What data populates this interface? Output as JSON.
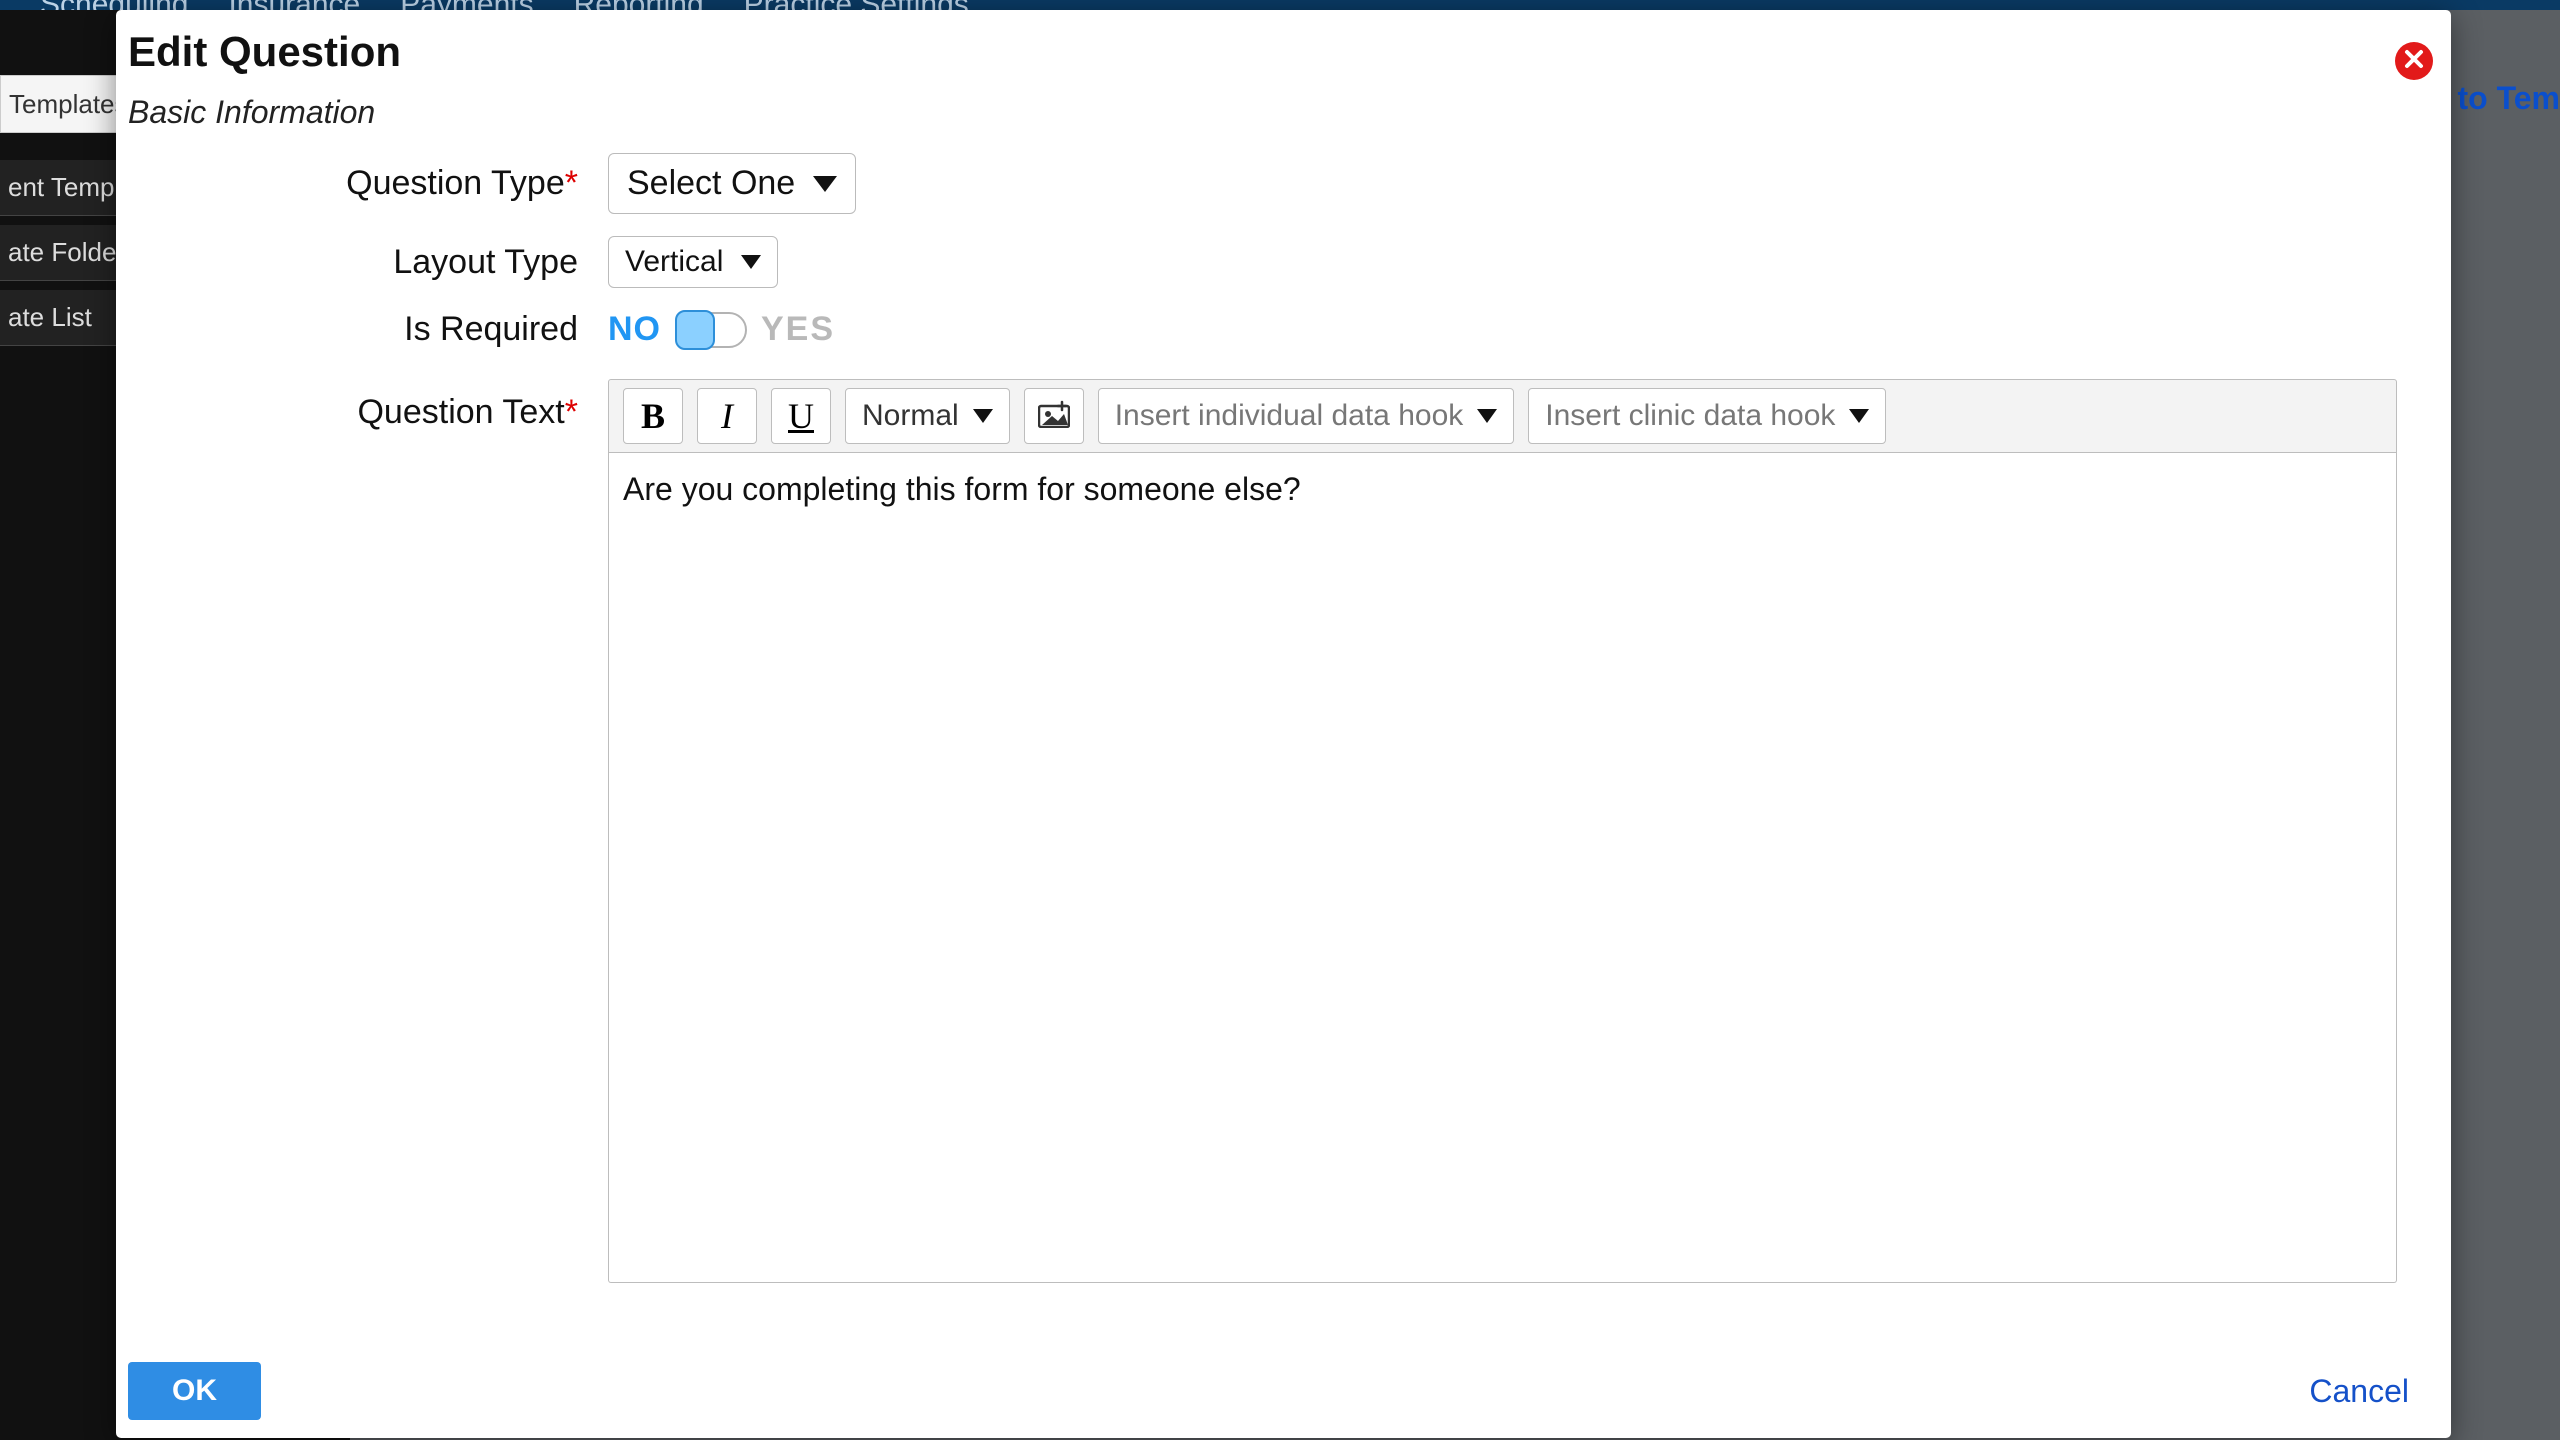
{
  "background": {
    "nav": [
      "Scheduling",
      "Insurance",
      "Payments",
      "Reporting",
      "Practice Settings"
    ],
    "tab": "Templates",
    "side_items": [
      "ent Temp",
      "ate Folde",
      "ate List"
    ],
    "back_link": "k to Tem"
  },
  "modal": {
    "title": "Edit Question",
    "subtitle": "Basic Information",
    "labels": {
      "question_type": "Question Type",
      "layout_type": "Layout Type",
      "is_required": "Is Required",
      "question_text": "Question Text"
    },
    "question_type_value": "Select One",
    "layout_type_value": "Vertical",
    "required": {
      "no": "NO",
      "yes": "YES",
      "value": false
    },
    "editor": {
      "style_select": "Normal",
      "individual_hook": "Insert individual data hook",
      "clinic_hook": "Insert clinic data hook",
      "content": "Are you completing this form for someone else?"
    },
    "footer": {
      "ok": "OK",
      "cancel": "Cancel"
    }
  }
}
